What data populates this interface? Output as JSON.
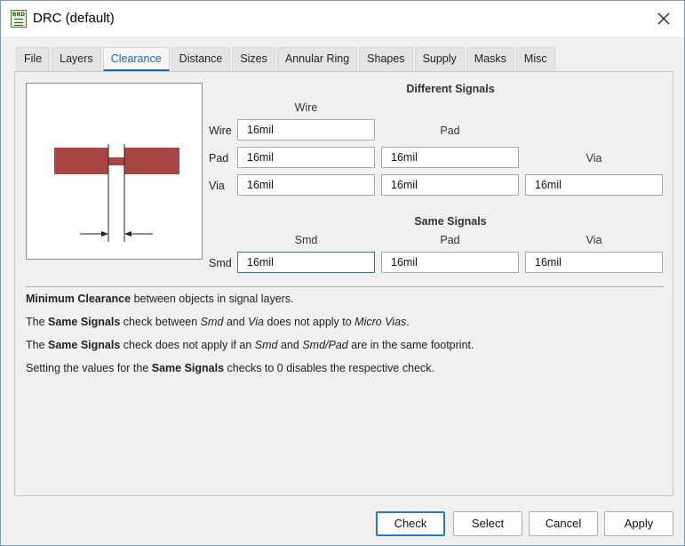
{
  "window": {
    "title": "DRC (default)",
    "icon_text": "BRD",
    "accent_color": "#1a66b3"
  },
  "tabs": [
    {
      "label": "File"
    },
    {
      "label": "Layers"
    },
    {
      "label": "Clearance",
      "active": true
    },
    {
      "label": "Distance"
    },
    {
      "label": "Sizes"
    },
    {
      "label": "Annular Ring"
    },
    {
      "label": "Shapes"
    },
    {
      "label": "Supply"
    },
    {
      "label": "Masks"
    },
    {
      "label": "Misc"
    }
  ],
  "different_signals": {
    "heading": "Different Signals",
    "col_wire": "Wire",
    "col_pad": "Pad",
    "col_via": "Via",
    "row_wire": "Wire",
    "row_pad": "Pad",
    "row_via": "Via",
    "wire_wire": "16mil",
    "pad_wire": "16mil",
    "pad_pad": "16mil",
    "via_wire": "16mil",
    "via_pad": "16mil",
    "via_via": "16mil"
  },
  "same_signals": {
    "heading": "Same Signals",
    "col_smd": "Smd",
    "col_pad": "Pad",
    "col_via": "Via",
    "row_smd": "Smd",
    "smd_smd": "16mil",
    "smd_pad": "16mil",
    "smd_via": "16mil"
  },
  "info": {
    "line1_bold": "Minimum Clearance",
    "line1_rest": " between objects in signal layers.",
    "line2_a": "The ",
    "line2_bold": "Same Signals",
    "line2_b": " check between ",
    "line2_i1": "Smd",
    "line2_c": " and ",
    "line2_i2": "Via",
    "line2_d": " does not apply to ",
    "line2_i3": "Micro Vias",
    "line2_e": ".",
    "line3_a": "The ",
    "line3_bold": "Same Signals",
    "line3_b": " check does not apply if an ",
    "line3_i1": "Smd",
    "line3_c": " and ",
    "line3_i2": "Smd/Pad",
    "line3_d": " are in the same footprint.",
    "line4_a": "Setting the values for the ",
    "line4_bold": "Same Signals",
    "line4_b": " checks to 0 disables the respective check."
  },
  "buttons": {
    "check": "Check",
    "select": "Select",
    "cancel": "Cancel",
    "apply": "Apply"
  },
  "preview": {
    "trace_color": "#a84646"
  }
}
